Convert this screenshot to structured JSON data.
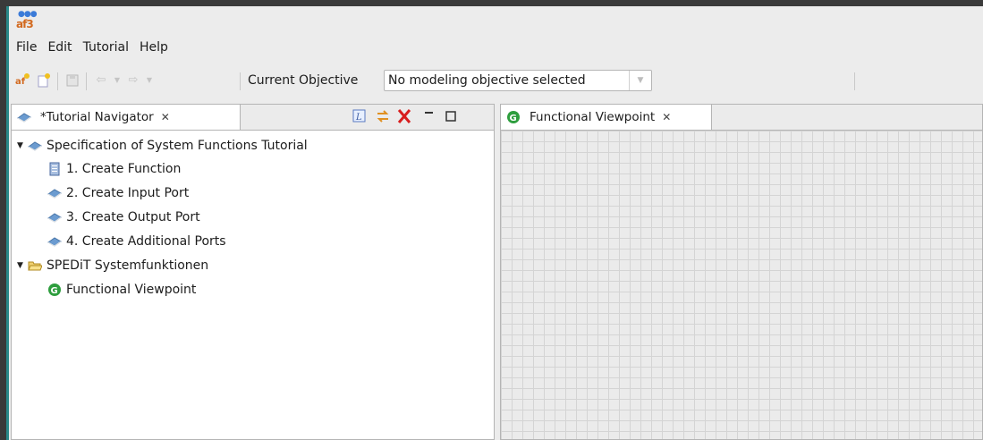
{
  "menu": [
    "File",
    "Edit",
    "Tutorial",
    "Help"
  ],
  "toolbar": {
    "objective_label": "Current Objective",
    "objective_value": "No modeling objective selected"
  },
  "navigator": {
    "tab_label": "*Tutorial Navigator",
    "tree": [
      {
        "label": "Specification of System Functions Tutorial",
        "level": 0,
        "expanded": true,
        "icon": "tutorial-book-icon"
      },
      {
        "label": "1. Create Function",
        "level": 1,
        "icon": "document-icon"
      },
      {
        "label": "2. Create Input Port",
        "level": 1,
        "icon": "tutorial-book-icon"
      },
      {
        "label": "3. Create Output Port",
        "level": 1,
        "icon": "tutorial-book-icon"
      },
      {
        "label": "4. Create Additional Ports",
        "level": 1,
        "icon": "tutorial-book-icon"
      },
      {
        "label": "SPEDiT Systemfunktionen",
        "level": 0,
        "expanded": true,
        "icon": "folder-open-icon"
      },
      {
        "label": "Functional Viewpoint",
        "level": 1,
        "icon": "green-g-icon"
      }
    ]
  },
  "editor": {
    "tab_label": "Functional Viewpoint"
  },
  "colors": {
    "accent_bar": "#2a8a8a",
    "green_icon": "#2e9e3e",
    "close_red": "#d81e1e",
    "book_blue": "#6b9bd0"
  }
}
